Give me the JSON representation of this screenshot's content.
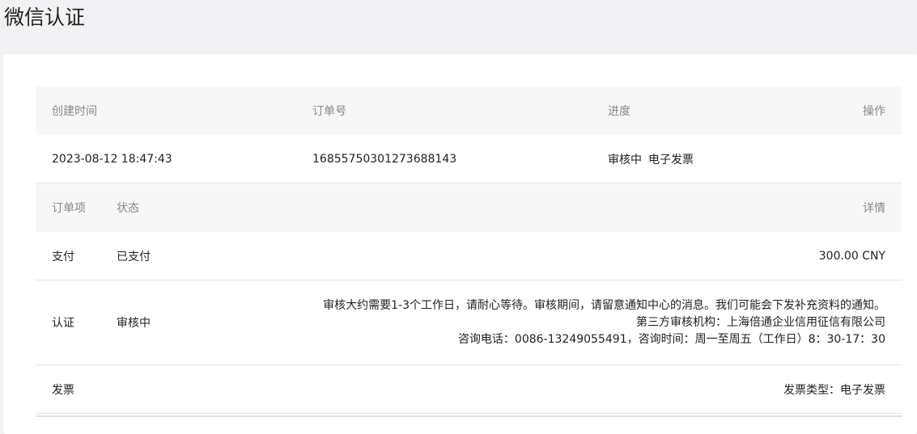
{
  "page_title": "微信认证",
  "order_table": {
    "headers": {
      "created_time": "创建时间",
      "order_no": "订单号",
      "progress": "进度",
      "actions": "操作"
    },
    "row": {
      "created_time": "2023-08-12 18:47:43",
      "order_no": "1685575030127368814​3",
      "progress_status": "审核中",
      "progress_item": "电子发票"
    }
  },
  "items_table": {
    "headers": {
      "item": "订单项",
      "status": "状态",
      "details": "详情"
    },
    "rows": [
      {
        "item": "支付",
        "status": "已支付",
        "detail": "300.00 CNY"
      },
      {
        "item": "认证",
        "status": "审核中",
        "detail_lines": [
          "审核大约需要1-3个工作日，请耐心等待。审核期间，请留意通知中心的消息。我们可能会下发补充资料的通知。",
          "第三方审核机构：上海倍通企业信用征信有限公司",
          "咨询电话：0086-13249055491，咨询时间：周一至周五（工作日）8：30-17：30"
        ]
      },
      {
        "item": "发票",
        "status": "",
        "detail": "发票类型：电子发票"
      }
    ]
  }
}
